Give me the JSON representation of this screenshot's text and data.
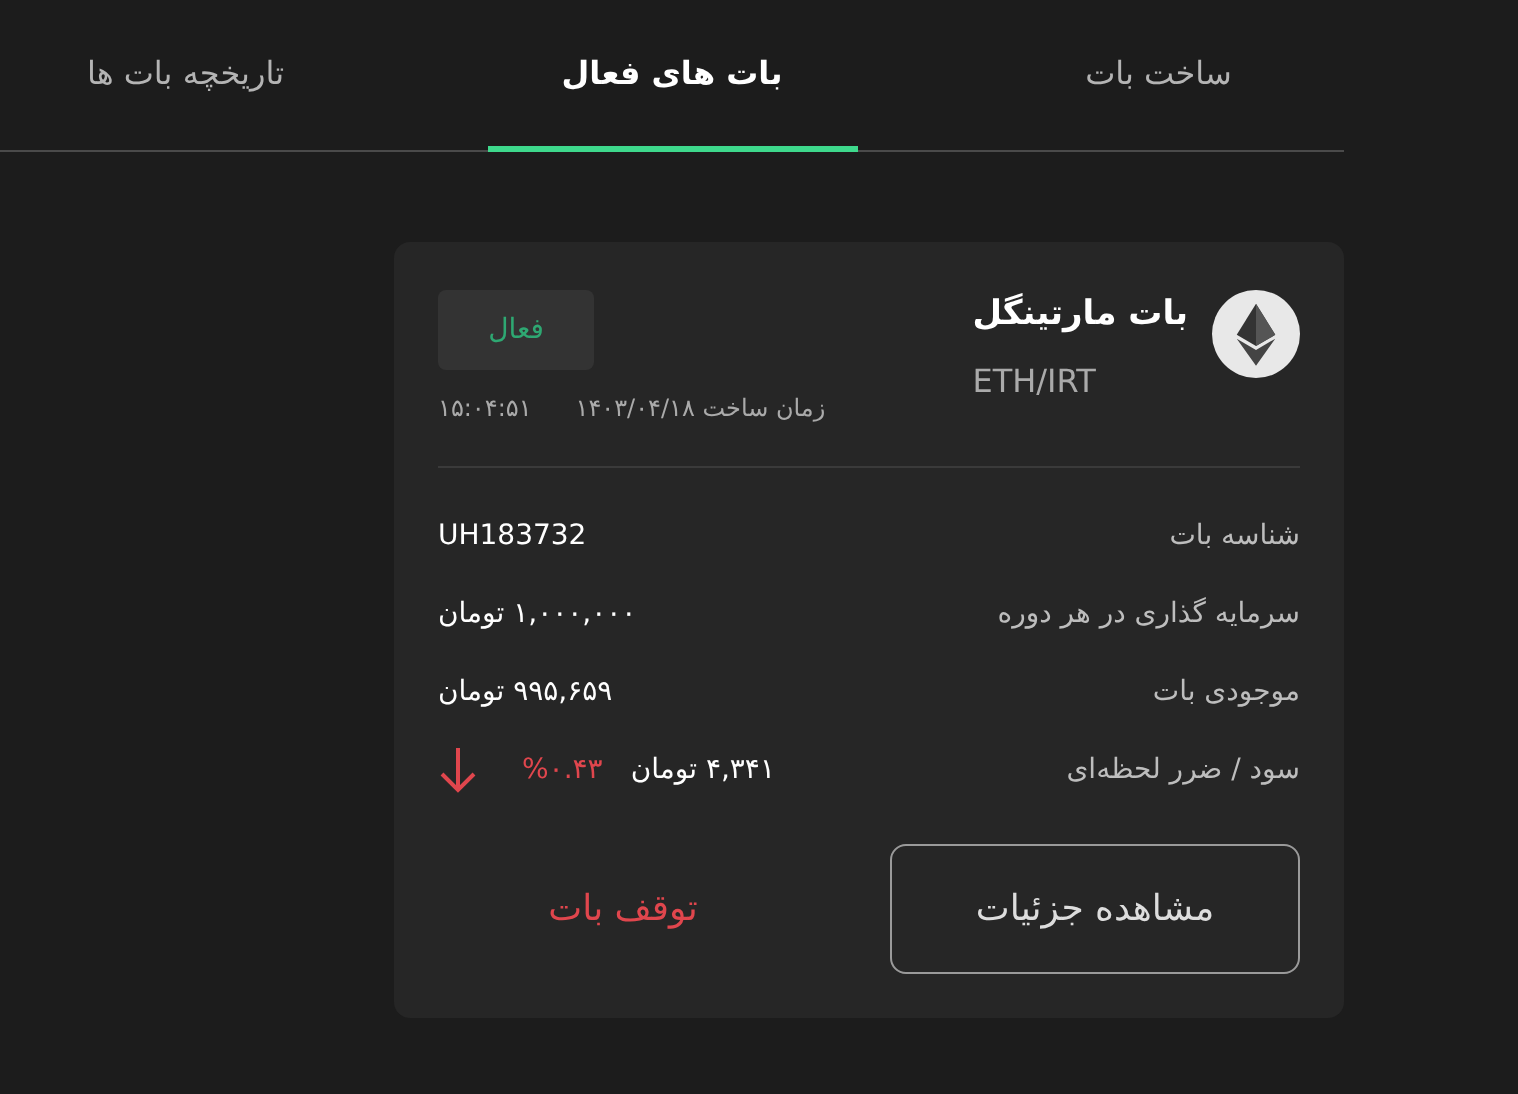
{
  "tabs": [
    {
      "label": "ساخت بات",
      "selected": false
    },
    {
      "label": "بات های فعال",
      "selected": true
    },
    {
      "label": "تاریخچه بات ها",
      "selected": false
    }
  ],
  "bot_card": {
    "name": "بات مارتینگل",
    "pair": "ETH/IRT",
    "status": "فعال",
    "created_label": "زمان ساخت ۱۴۰۳/۰۴/۱۸",
    "created_time": "۱۵:۰۴:۵۱",
    "rows": [
      {
        "label": "شناسه بات",
        "value": "UH183732"
      },
      {
        "label": "سرمایه گذاری در هر دوره",
        "value": "۱,۰۰۰,۰۰۰ تومان"
      },
      {
        "label": "موجودی بات",
        "value": "۹۹۵,۶۵۹ تومان"
      },
      {
        "label": "سود / ضرر لحظه‌ای",
        "value": "۴,۳۴۱ تومان",
        "change": "%۰.۴۳",
        "falling": true
      }
    ],
    "buttons": [
      {
        "label": "مشاهده جزئیات",
        "kind": "outline"
      },
      {
        "label": "توقف بات",
        "kind": "danger"
      }
    ]
  }
}
